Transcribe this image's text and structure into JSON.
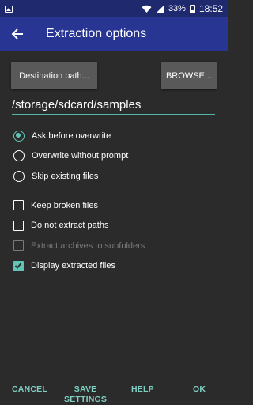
{
  "status_bar": {
    "battery": "33%",
    "time": "18:52"
  },
  "header": {
    "title": "Extraction options"
  },
  "destination": {
    "button_label": "Destination path...",
    "browse_label": "BROWSE...",
    "path_value": "/storage/sdcard/samples"
  },
  "overwrite_modes": [
    {
      "label": "Ask before overwrite",
      "selected": true
    },
    {
      "label": "Overwrite without prompt",
      "selected": false
    },
    {
      "label": "Skip existing files",
      "selected": false
    }
  ],
  "options": [
    {
      "label": "Keep broken files",
      "checked": false,
      "enabled": true
    },
    {
      "label": "Do not extract paths",
      "checked": false,
      "enabled": true
    },
    {
      "label": "Extract archives to subfolders",
      "checked": false,
      "enabled": false
    },
    {
      "label": "Display extracted files",
      "checked": true,
      "enabled": true
    }
  ],
  "actions": {
    "cancel": "CANCEL",
    "save_settings_line1": "SAVE",
    "save_settings_line2": "SETTINGS",
    "help": "HELP",
    "ok": "OK"
  },
  "colors": {
    "app_bar": "#283593",
    "accent": "#5fc3b5",
    "background": "#2b2b2b"
  }
}
